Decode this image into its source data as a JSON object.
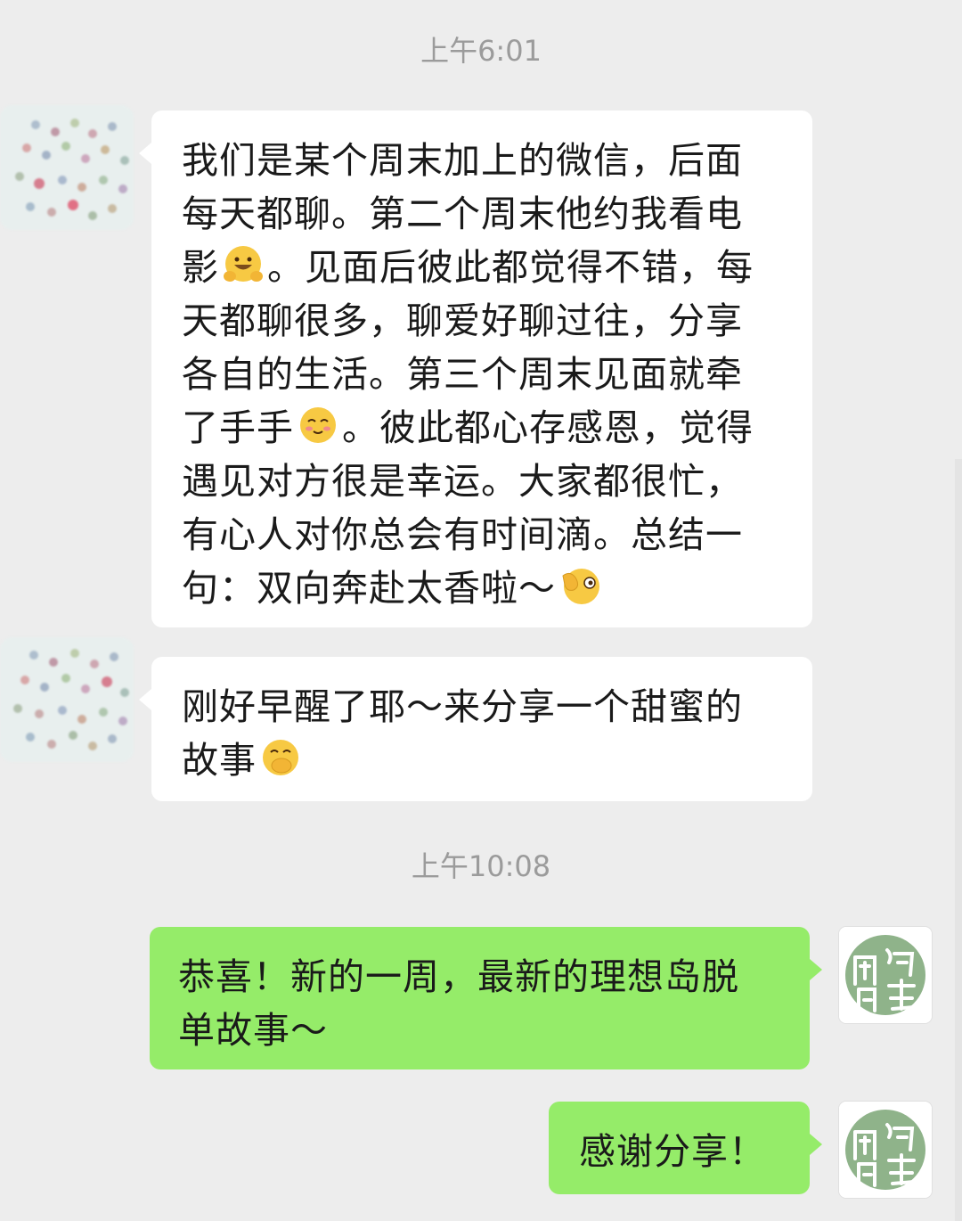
{
  "chat": {
    "timestamp_1": "上午6:01",
    "timestamp_2": "上午10:08",
    "message_1": {
      "lines": [
        [
          "我们是某个周末加上的微信，后面"
        ],
        [
          "每天都聊。第二个周末他约我看电"
        ],
        [
          "影",
          "。见面后彼此都觉得不错，每"
        ],
        [
          "天都聊很多，聊爱好聊过往，分享"
        ],
        [
          "各自的生活。第三个周末见面就牵"
        ],
        [
          "了手手",
          "。彼此都心存感恩，觉得"
        ],
        [
          "遇见对方很是幸运。大家都很忙，"
        ],
        [
          "有心人对你总会有时间滴。总结一"
        ],
        [
          "句：双向奔赴太香啦～"
        ]
      ],
      "emojis": [
        "grin-hands-emoji",
        "blush-emoji",
        "ok-wink-emoji"
      ]
    },
    "message_2": {
      "lines": [
        [
          "刚好早醒了耶～来分享一个甜蜜的"
        ],
        [
          "故事"
        ]
      ],
      "emojis": [
        "shy-cover-mouth-emoji"
      ]
    },
    "message_3": {
      "lines": [
        [
          "恭喜！新的一周，最新的理想岛脱"
        ],
        [
          "单故事～"
        ]
      ]
    },
    "message_4": {
      "lines": [
        [
          "感谢分享！"
        ]
      ]
    }
  },
  "colors": {
    "background": "#ededed",
    "incoming_bubble": "#ffffff",
    "outgoing_bubble": "#95ec69",
    "timestamp": "#9b9b9b",
    "avatar_self_green": "#8fb38a"
  }
}
